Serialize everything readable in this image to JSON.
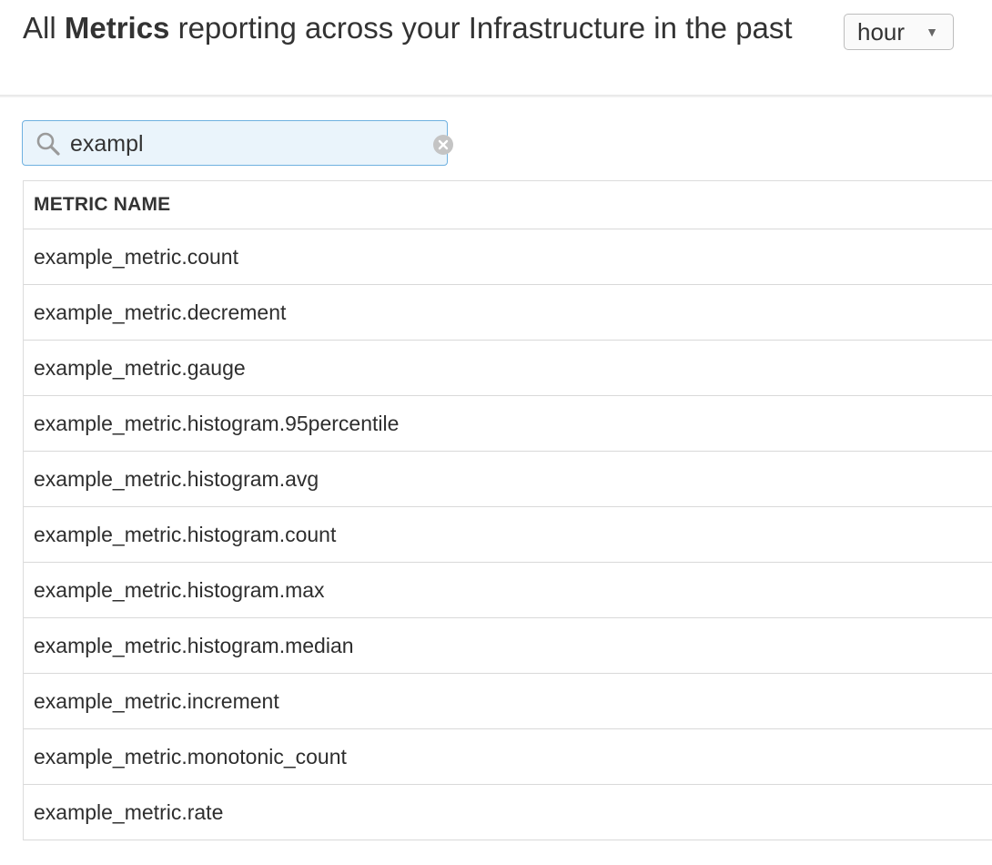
{
  "header": {
    "title_prefix": "All",
    "title_bold": "Metrics",
    "title_suffix": "reporting across your Infrastructure in the past",
    "time_range": {
      "selected": "hour"
    }
  },
  "search": {
    "value": "exampl",
    "placeholder": ""
  },
  "table": {
    "column_header": "METRIC NAME",
    "rows": [
      "example_metric.count",
      "example_metric.decrement",
      "example_metric.gauge",
      "example_metric.histogram.95percentile",
      "example_metric.histogram.avg",
      "example_metric.histogram.count",
      "example_metric.histogram.max",
      "example_metric.histogram.median",
      "example_metric.increment",
      "example_metric.monotonic_count",
      "example_metric.rate"
    ]
  },
  "icons": {
    "search": "search-icon",
    "clear": "clear-icon",
    "dropdown": "chevron-down-icon"
  },
  "colors": {
    "search_border": "#6fb1e0",
    "search_background": "#eaf4fb"
  }
}
